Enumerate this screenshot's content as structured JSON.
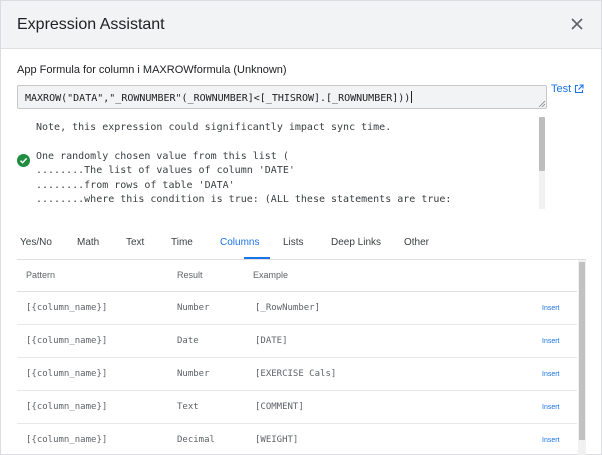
{
  "dialog": {
    "title": "Expression Assistant",
    "formula_label": "App Formula for column i MAXROWformula (Unknown)",
    "formula_value": "MAXROW(\"DATA\",\"_ROWNUMBER\"(_ROWNUMBER]<[_THISROW].[_ROWNUMBER]))",
    "test_label": "Test"
  },
  "explanation": {
    "lines": [
      "Note, this expression could significantly impact sync time.",
      "One randomly chosen value from this list (",
      "........The list of values of column 'DATE'",
      "........from rows of table 'DATA'",
      "........where this condition is true: (ALL these statements are true:"
    ]
  },
  "tabs": [
    "Yes/No",
    "Math",
    "Text",
    "Time",
    "Columns",
    "Lists",
    "Deep Links",
    "Other"
  ],
  "active_tab": "Columns",
  "table": {
    "headers": {
      "pattern": "Pattern",
      "result": "Result",
      "example": "Example"
    },
    "insert_label": "Insert",
    "rows": [
      {
        "pattern": "[{column_name}]",
        "result": "Number",
        "example": "[_RowNumber]"
      },
      {
        "pattern": "[{column_name}]",
        "result": "Date",
        "example": "[DATE]"
      },
      {
        "pattern": "[{column_name}]",
        "result": "Number",
        "example": "[EXERCISE Cals]"
      },
      {
        "pattern": "[{column_name}]",
        "result": "Text",
        "example": "[COMMENT]"
      },
      {
        "pattern": "[{column_name}]",
        "result": "Decimal",
        "example": "[WEIGHT]"
      }
    ]
  },
  "colors": {
    "accent": "#1a73e8",
    "success": "#1e8e3e"
  }
}
